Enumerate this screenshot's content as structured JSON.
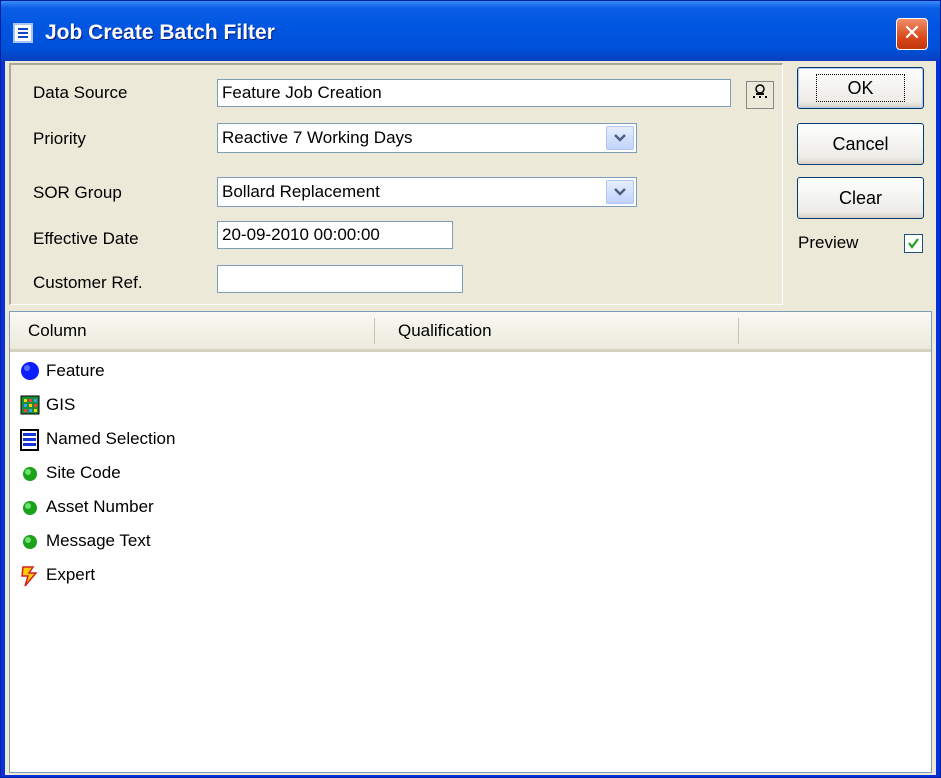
{
  "window": {
    "title": "Job Create Batch Filter"
  },
  "form": {
    "data_source": {
      "label": "Data Source",
      "value": "Feature Job Creation"
    },
    "priority": {
      "label": "Priority",
      "value": "Reactive 7 Working Days"
    },
    "sor_group": {
      "label": "SOR Group",
      "value": "Bollard Replacement"
    },
    "effective_date": {
      "label": "Effective Date",
      "value": "20-09-2010 00:00:00"
    },
    "customer_ref": {
      "label": "Customer Ref.",
      "value": ""
    }
  },
  "buttons": {
    "ok": "OK",
    "cancel": "Cancel",
    "clear": "Clear"
  },
  "preview": {
    "label": "Preview",
    "checked": true
  },
  "grid": {
    "columns": [
      "Column",
      "Qualification"
    ],
    "rows": [
      {
        "label": "Feature",
        "icon": "blue-circle-icon"
      },
      {
        "label": "GIS",
        "icon": "gis-grid-icon"
      },
      {
        "label": "Named Selection",
        "icon": "named-selection-icon"
      },
      {
        "label": "Site Code",
        "icon": "green-dot-icon"
      },
      {
        "label": "Asset Number",
        "icon": "green-dot-icon"
      },
      {
        "label": "Message Text",
        "icon": "green-dot-icon"
      },
      {
        "label": "Expert",
        "icon": "lightning-icon"
      }
    ]
  }
}
